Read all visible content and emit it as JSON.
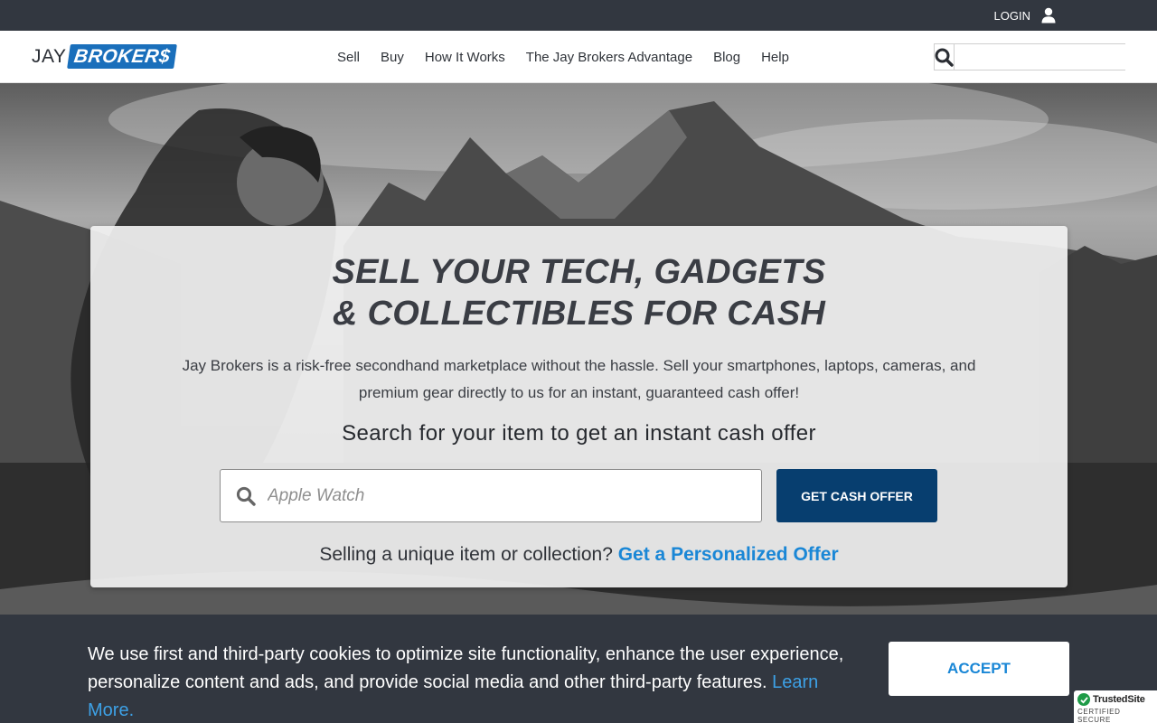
{
  "topbar": {
    "login_label": "LOGIN"
  },
  "logo": {
    "jay": "JAY",
    "brokers": "BROKER$"
  },
  "nav": {
    "items": [
      {
        "label": "Sell"
      },
      {
        "label": "Buy"
      },
      {
        "label": "How It Works"
      },
      {
        "label": "The Jay Brokers Advantage"
      },
      {
        "label": "Blog"
      },
      {
        "label": "Help"
      }
    ],
    "search_placeholder": ""
  },
  "hero": {
    "title_line1": "SELL YOUR TECH, GADGETS",
    "title_line2": "& COLLECTIBLES FOR CASH",
    "subtitle": "Jay Brokers is a risk-free secondhand marketplace without the hassle. Sell your smartphones, laptops, cameras, and premium gear directly to us for an instant, guaranteed cash offer!",
    "search_prompt": "Search for your item to get an instant cash offer",
    "search_placeholder": "Apple Watch",
    "cash_button": "GET CASH OFFER",
    "personal_prefix": "Selling a unique item or collection?",
    "personal_link": "Get a Personalized Offer"
  },
  "cookie": {
    "text": "We use first and third-party cookies to optimize site functionality, enhance the user experience, personalize content and ads, and provide social media and other third-party features.",
    "link": "Learn More.",
    "accept": "ACCEPT"
  },
  "trusted": {
    "name": "TrustedSite",
    "sub": "CERTIFIED SECURE"
  },
  "colors": {
    "topbar_bg": "#323740",
    "brand_blue": "#1a6fbb",
    "button_navy": "#073e6f",
    "link_blue": "#1a87d6",
    "trusted_green": "#1e9b47"
  }
}
